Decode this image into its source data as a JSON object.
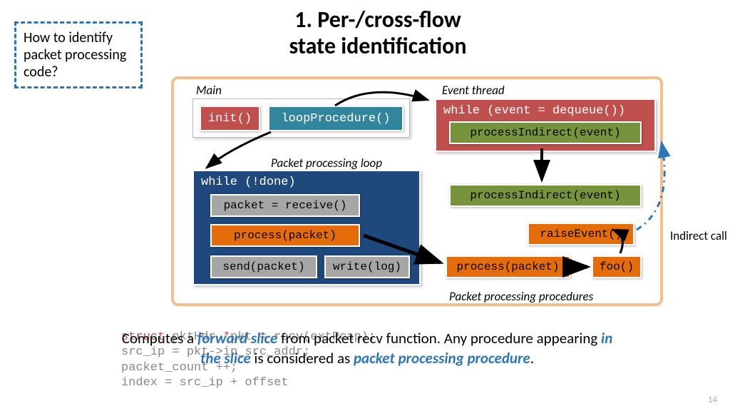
{
  "title_line1": "1. Per-/cross-flow",
  "title_line2": "state identification",
  "callout": "How to identify packet processing code?",
  "labels": {
    "main": "Main",
    "event": "Event thread",
    "loop": "Packet processing loop",
    "procs": "Packet processing procedures",
    "indirect": "Indirect call"
  },
  "boxes": {
    "init": "init()",
    "loopProc": "loopProcedure()",
    "whileEvent": "while (event = dequeue())",
    "pi": "processIndirect(event)",
    "whileDone": "while (!done)",
    "receive": "packet = receive()",
    "process": "process(packet)",
    "send": "send(packet)",
    "write": "write(log)",
    "foo": "foo()",
    "raise": "raiseEvent()"
  },
  "caption": {
    "t1": "Computes a ",
    "em1": "forward slice",
    "t2": " from packet recv function. Any procedure appearing ",
    "em2": "in the slice",
    "t3": " is considered as ",
    "em3": "packet processing procedure",
    "t4": "."
  },
  "code_bg": {
    "l1a": "struct",
    "l1b": " pktHdr ",
    "l1c": "*",
    "l1d": "pkt = recv(extPcap)",
    "l1e": ";",
    "l2": "src_ip = pkt->ip_src_addr;",
    "l3": "packet_count ++;",
    "l4": "index = src_ip + offset"
  },
  "slide_num": "14"
}
